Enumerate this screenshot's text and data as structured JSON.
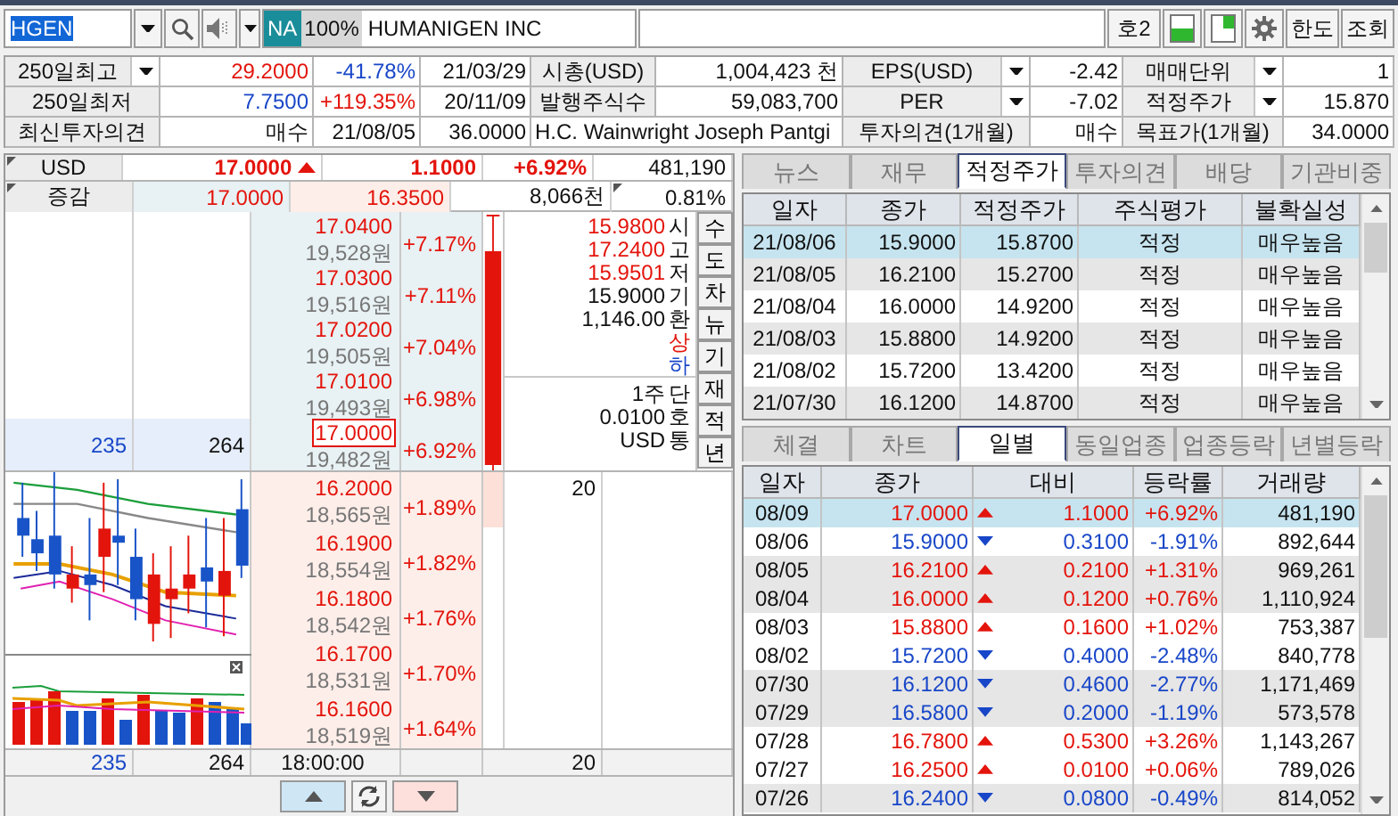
{
  "toolbar": {
    "symbol": "HGEN",
    "exchange": "NA",
    "zoom": "100%",
    "name": "HUMANIGEN INC",
    "buttons": [
      {
        "kind": "text",
        "label": "호2"
      },
      {
        "kind": "layout-left"
      },
      {
        "kind": "layout-right"
      },
      {
        "kind": "settings"
      },
      {
        "kind": "text",
        "label": "한도"
      },
      {
        "kind": "text",
        "label": "조회"
      }
    ]
  },
  "summary": [
    [
      {
        "kind": "select",
        "text": "250일최고"
      },
      {
        "kind": "value",
        "text": "29.2000",
        "color": "#e3140c"
      },
      {
        "kind": "value",
        "text": "-41.78%",
        "color": "#1846c8"
      },
      {
        "kind": "value",
        "text": "21/03/29",
        "color": "#111111"
      },
      {
        "kind": "label",
        "text": "시총(USD)"
      },
      {
        "kind": "value",
        "text": "1,004,423 천",
        "color": "#111111"
      },
      {
        "kind": "select",
        "text": "EPS(USD)"
      },
      {
        "kind": "value",
        "text": "-2.42",
        "color": "#111111"
      },
      {
        "kind": "select",
        "text": "매매단위"
      },
      {
        "kind": "value",
        "text": "1",
        "color": "#111111"
      }
    ],
    [
      {
        "kind": "label",
        "text": "250일최저"
      },
      {
        "kind": "value",
        "text": "7.7500",
        "color": "#1846c8"
      },
      {
        "kind": "value",
        "text": "+119.35%",
        "color": "#e3140c"
      },
      {
        "kind": "value",
        "text": "20/11/09",
        "color": "#111111"
      },
      {
        "kind": "label",
        "text": "발행주식수"
      },
      {
        "kind": "value",
        "text": "59,083,700",
        "color": "#111111"
      },
      {
        "kind": "select",
        "text": "PER"
      },
      {
        "kind": "value",
        "text": "-7.02",
        "color": "#111111"
      },
      {
        "kind": "select",
        "text": "적정주가"
      },
      {
        "kind": "value",
        "text": "15.870",
        "color": "#111111"
      }
    ],
    [
      {
        "kind": "label",
        "text": "최신투자의견"
      },
      {
        "kind": "value",
        "text": "매수",
        "color": "#111111"
      },
      {
        "kind": "value",
        "text": "21/08/05",
        "color": "#111111"
      },
      {
        "kind": "value",
        "text": "36.0000",
        "color": "#111111"
      },
      {
        "kind": "wide",
        "text": "H.C. Wainwright Joseph Pantgi",
        "color": "#111111"
      },
      {
        "kind": "label",
        "text": "투자의견(1개월)"
      },
      {
        "kind": "value",
        "text": "매수",
        "color": "#111111"
      },
      {
        "kind": "label",
        "text": "목표가(1개월)"
      },
      {
        "kind": "value",
        "text": "34.0000",
        "color": "#111111"
      }
    ]
  ],
  "quote": {
    "currency": "USD",
    "price": "17.0000",
    "rising": true,
    "change": "1.1000",
    "rate": "+6.92%",
    "volume": "481,190"
  },
  "range": {
    "label": "증감",
    "column_1": "17.0000",
    "column_2": "16.3500",
    "column_3": "8,066천",
    "column_4": "0.81%"
  },
  "asks": [
    {
      "price": "17.0400",
      "won": "19,528원",
      "rate": "+7.17%",
      "current": false
    },
    {
      "price": "17.0300",
      "won": "19,516원",
      "rate": "+7.11%",
      "current": false
    },
    {
      "price": "17.0200",
      "won": "19,505원",
      "rate": "+7.04%",
      "current": false
    },
    {
      "price": "17.0100",
      "won": "19,493원",
      "rate": "+6.98%",
      "current": false
    },
    {
      "price": "17.0000",
      "won": "19,482원",
      "rate": "+6.92%",
      "current": true,
      "ask_qty": "235",
      "bid_qty": "264"
    }
  ],
  "info": [
    {
      "number": "15.9800",
      "marker": "시",
      "color": "#e3140c"
    },
    {
      "number": "17.2400",
      "marker": "고",
      "color": "#e3140c"
    },
    {
      "number": "15.9501",
      "marker": "저",
      "color": "#e3140c"
    },
    {
      "number": "15.9000",
      "marker": "기",
      "color": "#111111"
    },
    {
      "number": "1,146.00",
      "marker": "환",
      "color": "#111111"
    },
    {
      "marker": "상",
      "color": "#e3140c"
    },
    {
      "marker": "하",
      "color": "#1846c8"
    }
  ],
  "units": [
    {
      "number": "1주",
      "marker": "단"
    },
    {
      "number": "0.0100",
      "marker": "호"
    },
    {
      "number": "USD",
      "marker": "통"
    }
  ],
  "side_buttons": [
    "수",
    "도",
    "차",
    "뉴",
    "기",
    "재",
    "적",
    "년"
  ],
  "bids": [
    {
      "price": "16.2000",
      "won": "18,565원",
      "rate": "+1.89%",
      "qty": "20"
    },
    {
      "price": "16.1900",
      "won": "18,554원",
      "rate": "+1.82%"
    },
    {
      "price": "16.1800",
      "won": "18,542원",
      "rate": "+1.76%"
    },
    {
      "price": "16.1700",
      "won": "18,531원",
      "rate": "+1.70%"
    },
    {
      "price": "16.1600",
      "won": "18,519원",
      "rate": "+1.64%"
    }
  ],
  "footer": {
    "ask_total": "235",
    "bid_total": "264",
    "time": "18:00:00",
    "qty": "20"
  },
  "info_tabs": [
    {
      "label": "뉴스",
      "selected": false
    },
    {
      "label": "재무",
      "selected": false
    },
    {
      "label": "적정주가",
      "selected": true
    },
    {
      "label": "투자의견",
      "selected": false
    },
    {
      "label": "배당",
      "selected": false
    },
    {
      "label": "기관비중",
      "selected": false
    }
  ],
  "fair_table": {
    "columns": [
      "일자",
      "종가",
      "적정주가",
      "주식평가",
      "불확실성"
    ],
    "rows": [
      {
        "date": "21/08/06",
        "close": "15.9000",
        "fair": "15.8700",
        "rating": "적정",
        "uncertainty": "매우높음",
        "selected": true
      },
      {
        "date": "21/08/05",
        "close": "16.2100",
        "fair": "15.2700",
        "rating": "적정",
        "uncertainty": "매우높음",
        "selected": false
      },
      {
        "date": "21/08/04",
        "close": "16.0000",
        "fair": "14.9200",
        "rating": "적정",
        "uncertainty": "매우높음",
        "selected": false
      },
      {
        "date": "21/08/03",
        "close": "15.8800",
        "fair": "14.9200",
        "rating": "적정",
        "uncertainty": "매우높음",
        "selected": false
      },
      {
        "date": "21/08/02",
        "close": "15.7200",
        "fair": "13.4200",
        "rating": "적정",
        "uncertainty": "매우높음",
        "selected": false
      },
      {
        "date": "21/07/30",
        "close": "16.1200",
        "fair": "14.8700",
        "rating": "적정",
        "uncertainty": "매우높음",
        "selected": false
      }
    ]
  },
  "trade_tabs": [
    {
      "label": "체결",
      "selected": false
    },
    {
      "label": "차트",
      "selected": false
    },
    {
      "label": "일별",
      "selected": true
    },
    {
      "label": "동일업종",
      "selected": false
    },
    {
      "label": "업종등락",
      "selected": false
    },
    {
      "label": "년별등락",
      "selected": false
    }
  ],
  "daily_table": {
    "columns": [
      "일자",
      "종가",
      "대비",
      "등락률",
      "거래량"
    ],
    "rows": [
      {
        "date": "08/09",
        "close": "17.0000",
        "rising": true,
        "change": "1.1000",
        "rate": "+6.92%",
        "volume": "481,190",
        "selected": true
      },
      {
        "date": "08/06",
        "close": "15.9000",
        "rising": false,
        "change": "0.3100",
        "rate": "-1.91%",
        "volume": "892,644",
        "selected": false
      },
      {
        "date": "08/05",
        "close": "16.2100",
        "rising": true,
        "change": "0.2100",
        "rate": "+1.31%",
        "volume": "969,261",
        "selected": false
      },
      {
        "date": "08/04",
        "close": "16.0000",
        "rising": true,
        "change": "0.1200",
        "rate": "+0.76%",
        "volume": "1,110,924",
        "selected": false
      },
      {
        "date": "08/03",
        "close": "15.8800",
        "rising": true,
        "change": "0.1600",
        "rate": "+1.02%",
        "volume": "753,387",
        "selected": false
      },
      {
        "date": "08/02",
        "close": "15.7200",
        "rising": false,
        "change": "0.4000",
        "rate": "-2.48%",
        "volume": "840,778",
        "selected": false
      },
      {
        "date": "07/30",
        "close": "16.1200",
        "rising": false,
        "change": "0.4600",
        "rate": "-2.77%",
        "volume": "1,171,469",
        "selected": false
      },
      {
        "date": "07/29",
        "close": "16.5800",
        "rising": false,
        "change": "0.2000",
        "rate": "-1.19%",
        "volume": "573,578",
        "selected": false
      },
      {
        "date": "07/28",
        "close": "16.7800",
        "rising": true,
        "change": "0.5300",
        "rate": "+3.26%",
        "volume": "1,143,267",
        "selected": false
      },
      {
        "date": "07/27",
        "close": "16.2500",
        "rising": true,
        "change": "0.0100",
        "rate": "+0.06%",
        "volume": "789,026",
        "selected": false
      },
      {
        "date": "07/26",
        "close": "16.2400",
        "rising": false,
        "change": "0.0800",
        "rate": "-0.49%",
        "volume": "814,052",
        "selected": false
      }
    ]
  }
}
